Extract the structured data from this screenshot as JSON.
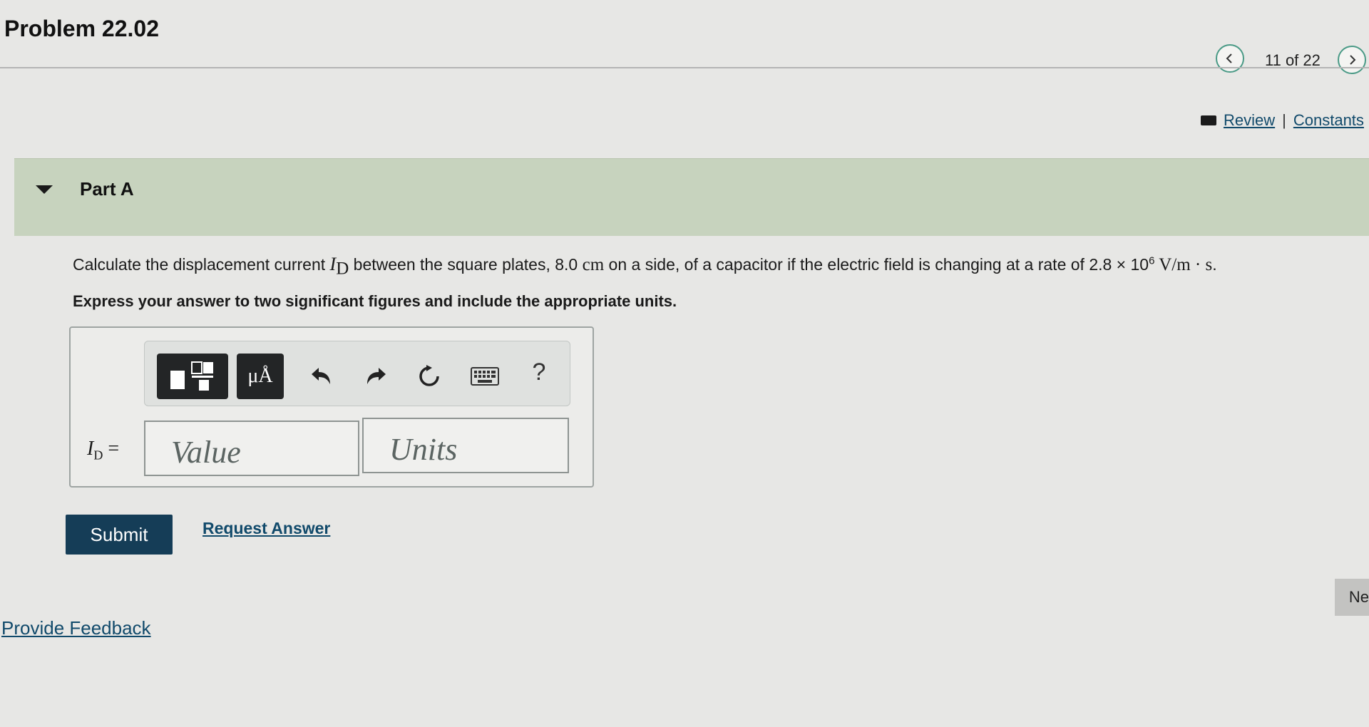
{
  "header": {
    "problem_title": "Problem 22.02",
    "page_count": "11 of 22",
    "prev_icon": "chevron-left-icon",
    "next_icon": "chevron-right-icon"
  },
  "resources": {
    "icon": "book-icon",
    "review_label": "Review",
    "separator": "|",
    "constants_label": "Constants"
  },
  "part": {
    "title": "Part A",
    "collapse_icon": "caret-down-icon"
  },
  "question": {
    "text_before": "Calculate the displacement current ",
    "symbol": "I",
    "symbol_sub": "D",
    "text_middle1": " between the square plates, 8.0 ",
    "unit_cm": "cm",
    "text_middle2": " on a side, of a capacitor if the electric field is changing at a rate of 2.8 × 10",
    "exponent": "6",
    "unit_rate": " V/m · s",
    "text_end": ".",
    "instruction": "Express your answer to two significant figures and include the appropriate units."
  },
  "toolbar": {
    "units_label": "μÅ",
    "help_label": "?"
  },
  "answer": {
    "variable": "I",
    "variable_sub": "D",
    "equals": " =",
    "value_placeholder": "Value",
    "units_placeholder": "Units"
  },
  "actions": {
    "submit_label": "Submit",
    "request_answer_label": "Request Answer",
    "feedback_label": "Provide Feedback",
    "next_label": "Ne"
  },
  "colors": {
    "accent_teal": "#4a9a86",
    "submit_bg": "#153d57",
    "link": "#114a6b",
    "part_band": "#c7d3be"
  }
}
